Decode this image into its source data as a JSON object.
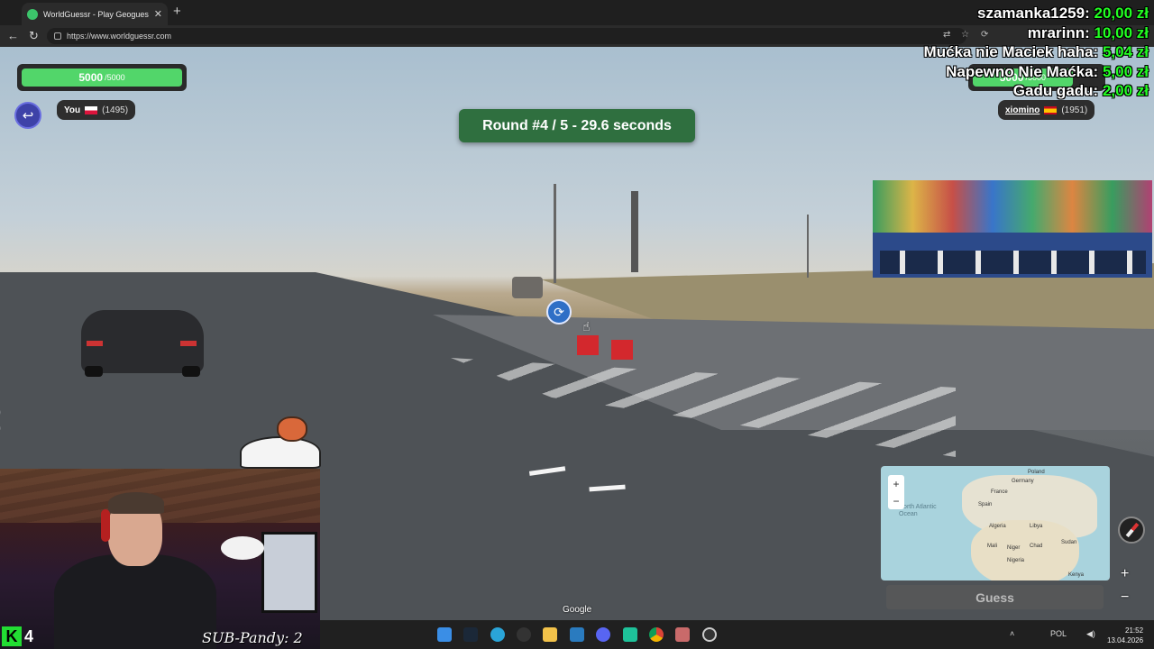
{
  "browser": {
    "tab_title": "WorldGuessr - Play Geoguessr for",
    "tab_close": "✕",
    "new_tab": "+",
    "url": "https://www.worldguessr.com"
  },
  "game": {
    "player_hp": "5000",
    "player_hp_max": "/5000",
    "player_hp_fraction": 1.0,
    "opponent_hp": "5000",
    "opponent_hp_max": "/5000",
    "opponent_hp_fraction": 0.78,
    "player_name": "You",
    "player_elo": "(1495)",
    "opponent_name": "xiomino",
    "opponent_elo": "(1951)",
    "round_banner": "Round #4 / 5 - 29.6 seconds",
    "guess_label": "Guess",
    "google_mark": "Google"
  },
  "donations": [
    {
      "name": "szamanka1259:",
      "amount": "20,00 zł"
    },
    {
      "name": "mrarinn:",
      "amount": "10,00 zł"
    },
    {
      "name": "Mućka nie Maciek haha:",
      "amount": "5,04 zł"
    },
    {
      "name": "Napewno Nie Maćka:",
      "amount": "5,00 zł"
    },
    {
      "name": "Gadu gadu:",
      "amount": "2,00 zł"
    }
  ],
  "minimap": {
    "labels": [
      "Poland",
      "Germany",
      "France",
      "Spain",
      "Algeria",
      "Libya",
      "Mali",
      "Niger",
      "Nigeria",
      "Kenya",
      "Chad",
      "Sudan"
    ],
    "sea": "North Atlantic Ocean",
    "zoom_in": "+",
    "zoom_out": "−"
  },
  "stream": {
    "sub_text": "SUB-Pandy: 2",
    "kick_logo": "K",
    "kick_count": "4"
  },
  "taskbar": {
    "lang": "POL",
    "time": "21:52",
    "date": "13.04.2026"
  },
  "colors": {
    "hp_green": "#52d66a",
    "round_green": "#2f6f3f",
    "donation_amount": "#22ff22"
  }
}
